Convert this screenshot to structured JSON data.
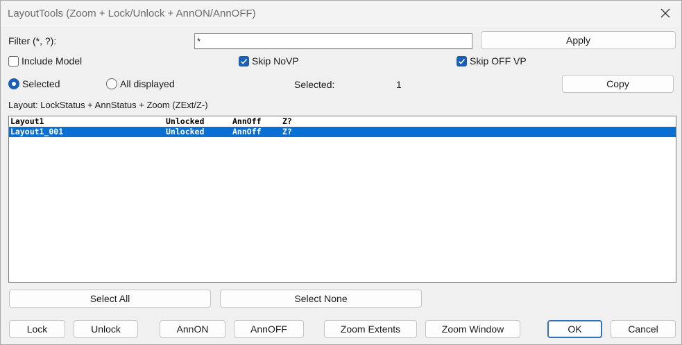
{
  "window": {
    "title": "LayoutTools (Zoom + Lock/Unlock + AnnON/AnnOFF)"
  },
  "filter": {
    "label": "Filter (*, ?):",
    "value": "*",
    "apply_label": "Apply"
  },
  "options": {
    "include_model": {
      "label": "Include Model",
      "checked": false
    },
    "skip_novp": {
      "label": "Skip NoVP",
      "checked": true
    },
    "skip_off_vp": {
      "label": "Skip OFF VP",
      "checked": true
    }
  },
  "scope": {
    "selected_label": "Selected",
    "all_displayed_label": "All displayed",
    "selected_choice": "Selected"
  },
  "selection": {
    "count_label": "Selected:",
    "count_value": "1",
    "copy_label": "Copy"
  },
  "list": {
    "header": "Layout: LockStatus + AnnStatus + Zoom (ZExt/Z-)",
    "rows": [
      {
        "name": "Layout1",
        "lock": "Unlocked",
        "ann": "AnnOff",
        "zoom": "Z?",
        "selected": false
      },
      {
        "name": "Layout1_001",
        "lock": "Unlocked",
        "ann": "AnnOff",
        "zoom": "Z?",
        "selected": true
      }
    ]
  },
  "select_buttons": {
    "select_all": "Select All",
    "select_none": "Select None"
  },
  "actions": {
    "lock": "Lock",
    "unlock": "Unlock",
    "ann_on": "AnnON",
    "ann_off": "AnnOFF",
    "zoom_extents": "Zoom Extents",
    "zoom_window": "Zoom Window",
    "ok": "OK",
    "cancel": "Cancel"
  },
  "colors": {
    "accent": "#1a5fb4",
    "selection": "#0a6fd0",
    "background": "#f0f0f0"
  }
}
